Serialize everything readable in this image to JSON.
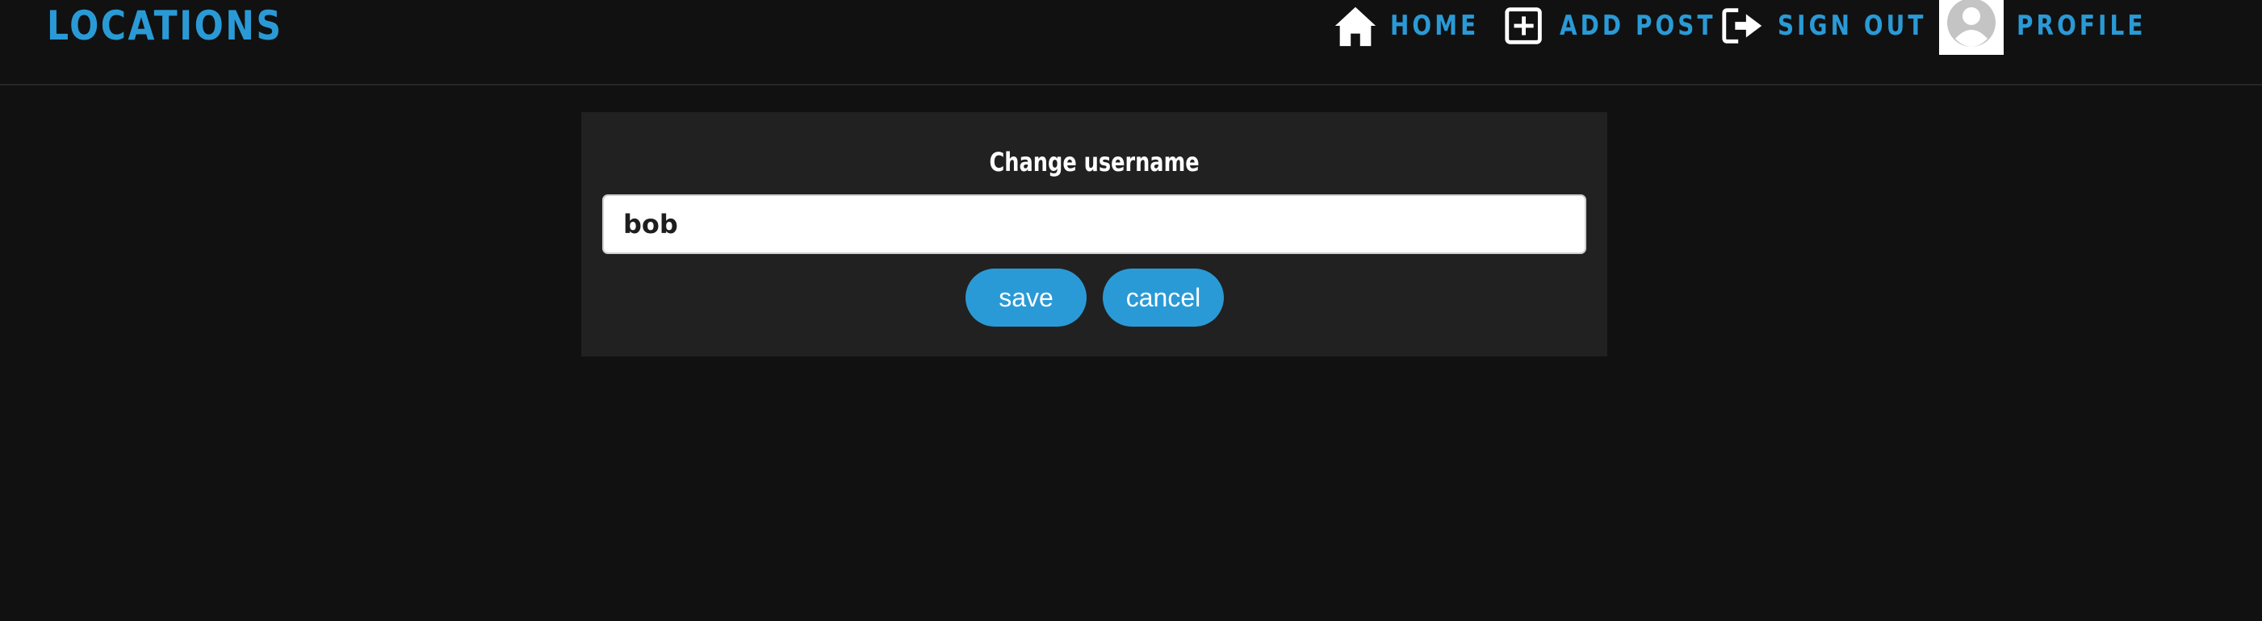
{
  "header": {
    "brand": "LOCATIONS",
    "nav": {
      "home": {
        "label": "HOME",
        "icon": "home-icon"
      },
      "add_post": {
        "label": "ADD POST",
        "icon": "plus-square-icon"
      },
      "sign_out": {
        "label": "SIGN OUT",
        "icon": "sign-out-icon"
      },
      "profile": {
        "label": "PROFILE",
        "icon": "avatar-icon"
      }
    }
  },
  "form": {
    "title": "Change username",
    "username_value": "bob",
    "save_label": "save",
    "cancel_label": "cancel"
  },
  "colors": {
    "accent": "#2a9ad6",
    "background": "#111111",
    "card": "#212121"
  }
}
